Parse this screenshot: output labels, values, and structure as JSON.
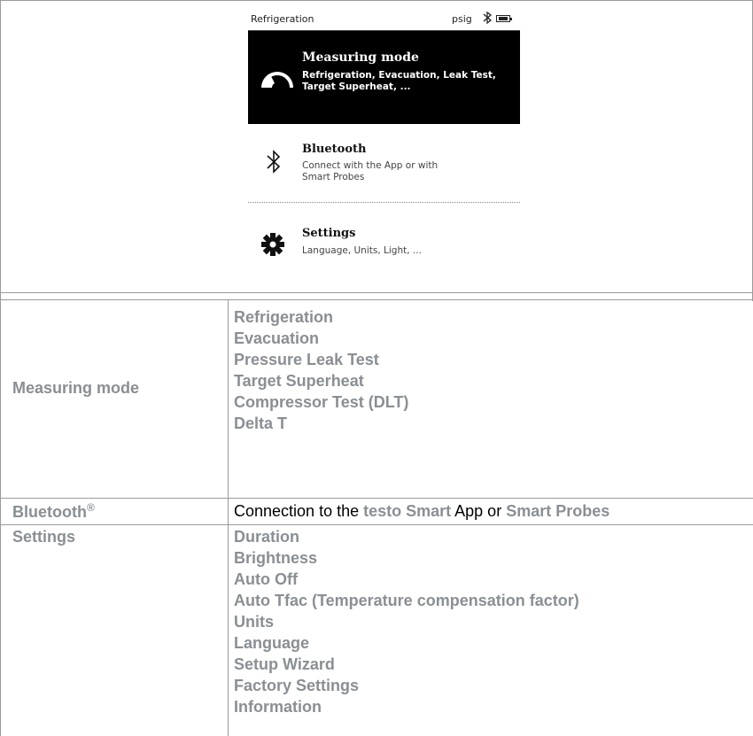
{
  "device_screen": {
    "status_bar": {
      "title": "Refrigeration",
      "unit": "psig",
      "bluetooth_icon": "bluetooth-icon",
      "battery_icon": "battery-icon"
    },
    "menu_items": [
      {
        "title": "Measuring mode",
        "description": "Refrigeration, Evacuation, Leak Test, Target Superheat, ...",
        "icon": "gauge-icon",
        "selected": true
      },
      {
        "title": "Bluetooth",
        "description": "Connect with the App or with Smart Probes",
        "icon": "bluetooth-icon",
        "selected": false
      },
      {
        "title": "Settings",
        "description": "Language, Units, Light, ...",
        "icon": "gear-icon",
        "selected": false
      }
    ]
  },
  "table": {
    "rows": [
      {
        "label": "Measuring mode",
        "items": [
          "Refrigeration",
          "Evacuation",
          "Pressure Leak Test",
          "Target Superheat",
          "Compressor Test (DLT)",
          "Delta T"
        ]
      },
      {
        "label": "Bluetooth",
        "label_sup": "®",
        "sentence": {
          "part1": "Connection to the ",
          "link1": "testo Smart",
          "part2": " App or ",
          "link2": "Smart Probes"
        }
      },
      {
        "label": "Settings",
        "items": [
          "Duration",
          "Brightness",
          "Auto Off",
          "Auto Tfac (Temperature compensation factor)",
          "Units",
          "Language",
          "Setup Wizard",
          "Factory Settings",
          "Information"
        ]
      }
    ]
  },
  "colors": {
    "highlight_text": "#8a8f94",
    "table_lines": "#9a9a9a",
    "selected_background": "#000000"
  }
}
